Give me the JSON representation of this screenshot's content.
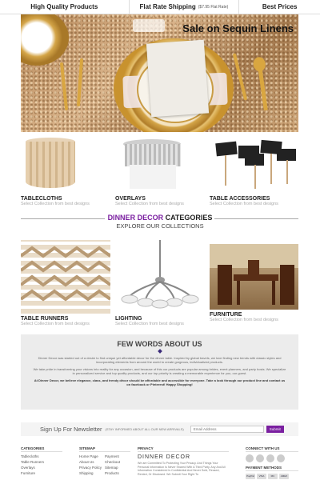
{
  "topbar": {
    "item1": "High Quality Products",
    "item2": "Flat Rate Shipping",
    "item2_note": "($7.95 Flat Rate)",
    "item3": "Best Prices"
  },
  "hero": {
    "title": "Sale on Sequin Linens"
  },
  "products_row1": [
    {
      "title": "TABLECLOTHS",
      "sub": "Select Collection from best designs"
    },
    {
      "title": "OVERLAYS",
      "sub": "Select Collection from best designs"
    },
    {
      "title": "TABLE ACCESSORIES",
      "sub": "Select Collection from best designs"
    }
  ],
  "categories": {
    "brand": "DINNER DECOR",
    "rest": " CATEGORIES",
    "subtitle": "EXPLORE OUR COLLECTIONS",
    "brand_color": "#7a1fa0"
  },
  "products_row2": [
    {
      "title": "TABLE RUNNERS",
      "sub": "Select Collection from best designs"
    },
    {
      "title": "LIGHTING",
      "sub": "Select Collection from best designs"
    },
    {
      "title": "FURNITURE",
      "sub": "Select Collection from best designs"
    }
  ],
  "few_words": {
    "title": "FEW WORDS ABOUT US",
    "p1": "Dinner Decor was started out of a desire to find unique yet affordable decor for the dinner table. Inspired by global travels, we love finding new trends with classic styles and incorporating elements from around the world to create gorgeous, individualized products.",
    "p2": "We take pride in transforming your visions into reality for any occasion, and because of this our products are popular among brides, event planners, and party hosts. We specialize in personalized service and top quality products, and our top priority is creating a memorable experience for you, our guest.",
    "p3": "At Dinner Decor, we believe elegance, class, and trendy décor should be affordable and accessible for everyone. Take a look through our product line and contact us on facebook or Pinterest! Happy Shopping!"
  },
  "newsletter": {
    "label": "Sign Up For Newsletter",
    "note": "(STAY INFORMED ABOUT ALL OUR NEW ARRIVALS)",
    "placeholder": "Email Address",
    "button": "Submit"
  },
  "footer": {
    "categories_heading": "CATEGORIES",
    "categories": [
      "Tablecloths",
      "Table Runners",
      "Overlays",
      "Furniture"
    ],
    "sitemap_heading": "SITEMAP",
    "sitemap_col1": [
      "Home Page",
      "About Us",
      "Privacy Policy",
      "Shipping"
    ],
    "sitemap_col2": [
      "Payment",
      "Checkout",
      "Sitemap",
      "Products"
    ],
    "privacy_heading": "PRIVACY",
    "privacy_brand": "DINNER DECOR",
    "privacy_text": "We are Committed To Protecting Your Privacy. And Things Your Personal Information Is Never Shared With A Third Party. Any And All Information Considered Is Confidential And Never Sold, Reused, Rented, Or Disclosed. We Submit Your Right To",
    "connect_heading": "CONNECT WITH US",
    "payment_heading": "PAYMENT METHODS",
    "payments": [
      "PayPal",
      "VISA",
      "MC",
      "AMEX"
    ]
  }
}
